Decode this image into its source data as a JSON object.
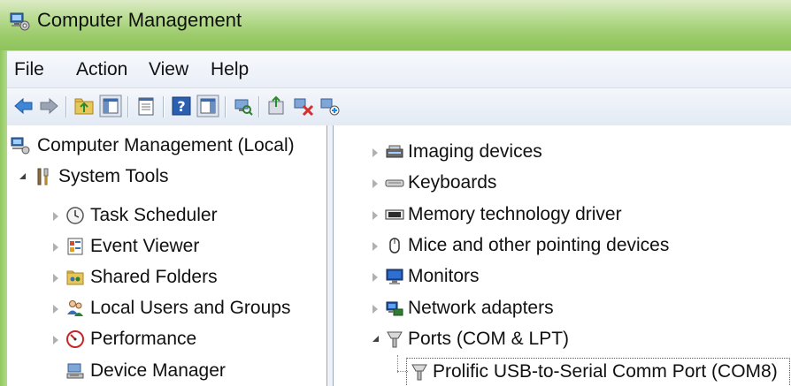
{
  "window": {
    "title": "Computer Management"
  },
  "menu": {
    "items": [
      "File",
      "Action",
      "View",
      "Help"
    ]
  },
  "toolbar": {
    "icons": [
      "back-arrow-icon",
      "forward-arrow-icon",
      "up-folder-icon",
      "show-hide-tree-icon",
      "properties-icon",
      "help-icon",
      "show-hide-action-pane-icon",
      "scan-hardware-icon",
      "update-driver-icon",
      "disable-device-icon",
      "uninstall-device-icon"
    ]
  },
  "left_tree": {
    "root": "Computer Management (Local)",
    "system_tools": "System Tools",
    "items": [
      {
        "label": "Task Scheduler",
        "icon": "clock-icon"
      },
      {
        "label": "Event Viewer",
        "icon": "event-viewer-icon"
      },
      {
        "label": "Shared Folders",
        "icon": "shared-folders-icon"
      },
      {
        "label": "Local Users and Groups",
        "icon": "users-icon"
      },
      {
        "label": "Performance",
        "icon": "performance-icon"
      },
      {
        "label": "Device Manager",
        "icon": "device-manager-icon"
      }
    ]
  },
  "right_tree": {
    "items": [
      {
        "label": "Imaging devices",
        "icon": "imaging-device-icon"
      },
      {
        "label": "Keyboards",
        "icon": "keyboard-icon"
      },
      {
        "label": "Memory technology driver",
        "icon": "memory-icon"
      },
      {
        "label": "Mice and other pointing devices",
        "icon": "mouse-icon"
      },
      {
        "label": "Monitors",
        "icon": "monitor-icon"
      },
      {
        "label": "Network adapters",
        "icon": "network-adapter-icon"
      },
      {
        "label": "Ports (COM & LPT)",
        "icon": "port-icon"
      }
    ],
    "child": {
      "label": "Prolific USB-to-Serial Comm Port (COM8)",
      "icon": "port-icon"
    }
  }
}
